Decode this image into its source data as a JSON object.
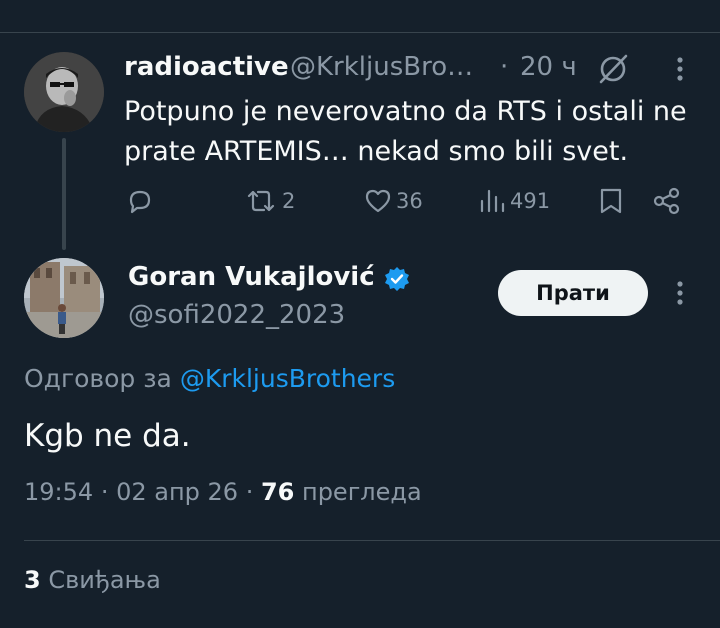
{
  "parent_tweet": {
    "display_name": "radioactive",
    "handle": "@KrkljusBro…",
    "separator": "·",
    "time": "20 ч",
    "text": "Potpuno je neverovatno da RTS i ostali ne prate ARTEMIS… nekad smo bili svet.",
    "actions": {
      "reply_count": "",
      "retweet_count": "2",
      "like_count": "36",
      "view_count": "491"
    }
  },
  "main_tweet": {
    "display_name": "Goran Vukajlović",
    "handle": "@sofi2022_2023",
    "follow_label": "Прати",
    "reply_to_prefix": "Одговор за ",
    "reply_to_handle": "@KrkljusBrothers",
    "text": "Kgb ne da.",
    "time": "19:54",
    "date": "02 апр 26",
    "views_count": "76",
    "views_label": "прегледа",
    "likes_count": "3",
    "likes_label": "Свиђања"
  },
  "colors": {
    "background": "#15202b",
    "text_primary": "#f7f9f9",
    "text_secondary": "#8b98a5",
    "accent": "#1d9bf0",
    "divider": "#38444d"
  },
  "icons": [
    "reply-icon",
    "retweet-icon",
    "like-icon",
    "views-icon",
    "bookmark-icon",
    "share-icon",
    "more-icon",
    "grok-icon",
    "verified-badge-icon"
  ]
}
